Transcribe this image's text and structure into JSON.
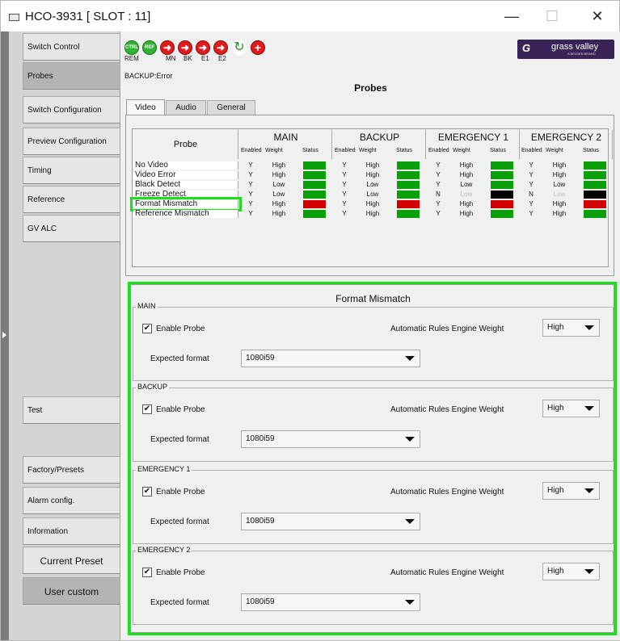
{
  "window": {
    "title": "HCO-3931 [ SLOT : 11]",
    "minimize": "—",
    "maximize": "☐",
    "close": "✕"
  },
  "nav": {
    "items": [
      {
        "label": "Switch Control"
      },
      {
        "label": "Probes"
      },
      {
        "label": "Switch Configuration"
      },
      {
        "label": "Preview Configuration"
      },
      {
        "label": "Timing"
      },
      {
        "label": "Reference"
      },
      {
        "label": "GV ALC"
      },
      {
        "label": "Test"
      },
      {
        "label": "Factory/Presets"
      },
      {
        "label": "Alarm config."
      },
      {
        "label": "Information"
      },
      {
        "label": "Current Preset"
      },
      {
        "label": "User custom"
      }
    ]
  },
  "toolbar": {
    "ctrl": "CTRL",
    "ref": "REF",
    "labels": [
      "REM",
      "MN",
      "BK",
      "E1",
      "E2"
    ],
    "logo": {
      "swirl": "G",
      "brand": "grass valley",
      "sub": "A BELDEN BRAND"
    }
  },
  "status": {
    "backup": "BACKUP:Error"
  },
  "page": {
    "title": "Probes"
  },
  "tabs": [
    "Video",
    "Audio",
    "General"
  ],
  "probes_table": {
    "probe_header": "Probe",
    "groups": [
      "MAIN",
      "BACKUP",
      "EMERGENCY 1",
      "EMERGENCY 2"
    ],
    "sub_headers": [
      "Enabled",
      "Weight",
      "Status"
    ],
    "rows": [
      {
        "name": "No Video",
        "cells": [
          [
            "Y",
            "High",
            "green"
          ],
          [
            "Y",
            "High",
            "green"
          ],
          [
            "Y",
            "High",
            "green"
          ],
          [
            "Y",
            "High",
            "green"
          ]
        ]
      },
      {
        "name": "Video Error",
        "cells": [
          [
            "Y",
            "High",
            "green"
          ],
          [
            "Y",
            "High",
            "green"
          ],
          [
            "Y",
            "High",
            "green"
          ],
          [
            "Y",
            "High",
            "green"
          ]
        ]
      },
      {
        "name": "Black Detect",
        "cells": [
          [
            "Y",
            "Low",
            "green"
          ],
          [
            "Y",
            "Low",
            "green"
          ],
          [
            "Y",
            "Low",
            "green"
          ],
          [
            "Y",
            "Low",
            "green"
          ]
        ]
      },
      {
        "name": "Freeze Detect",
        "cells": [
          [
            "Y",
            "Low",
            "green"
          ],
          [
            "Y",
            "Low",
            "green"
          ],
          [
            "N",
            "Low",
            "black"
          ],
          [
            "N",
            "Low",
            "black"
          ]
        ]
      },
      {
        "name": "Format Mismatch",
        "cells": [
          [
            "Y",
            "High",
            "red"
          ],
          [
            "Y",
            "High",
            "red"
          ],
          [
            "Y",
            "High",
            "red"
          ],
          [
            "Y",
            "High",
            "red"
          ]
        ]
      },
      {
        "name": "Reference Mismatch",
        "cells": [
          [
            "Y",
            "High",
            "green"
          ],
          [
            "Y",
            "High",
            "green"
          ],
          [
            "Y",
            "High",
            "green"
          ],
          [
            "Y",
            "High",
            "green"
          ]
        ]
      }
    ]
  },
  "format_mismatch": {
    "title": "Format Mismatch",
    "groups": [
      {
        "name": "MAIN",
        "enable_label": "Enable Probe",
        "checked": "✔",
        "weight_label": "Automatic Rules Engine Weight",
        "weight": "High",
        "format_label": "Expected format",
        "format": "1080i59"
      },
      {
        "name": "BACKUP",
        "enable_label": "Enable Probe",
        "checked": "✔",
        "weight_label": "Automatic Rules Engine Weight",
        "weight": "High",
        "format_label": "Expected format",
        "format": "1080i59"
      },
      {
        "name": "EMERGENCY 1",
        "enable_label": "Enable Probe",
        "checked": "✔",
        "weight_label": "Automatic Rules Engine Weight",
        "weight": "High",
        "format_label": "Expected format",
        "format": "1080i59"
      },
      {
        "name": "EMERGENCY 2",
        "enable_label": "Enable Probe",
        "checked": "✔",
        "weight_label": "Automatic Rules Engine Weight",
        "weight": "High",
        "format_label": "Expected format",
        "format": "1080i59"
      }
    ]
  },
  "colors": {
    "green": "#0aa00a",
    "red": "#d40000",
    "black": "#000000",
    "highlight": "#1ae01a"
  }
}
